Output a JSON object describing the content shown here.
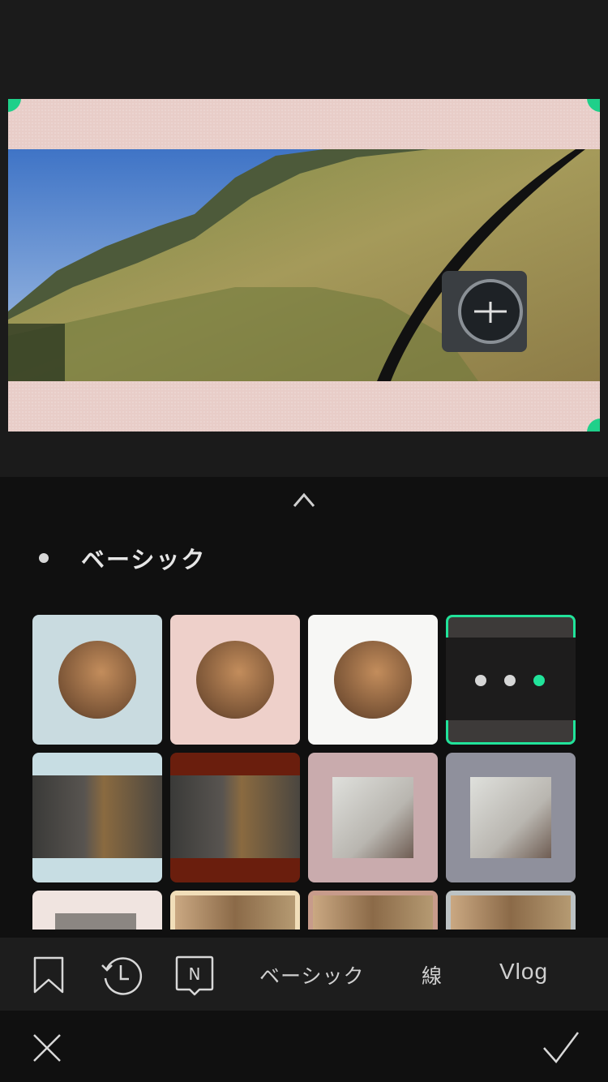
{
  "panel": {
    "section_title": "ベーシック"
  },
  "tabs": [
    {
      "type": "icon",
      "name": "bookmark-icon"
    },
    {
      "type": "icon",
      "name": "history-icon"
    },
    {
      "type": "icon",
      "name": "new-badge-icon",
      "glyph": "N"
    },
    {
      "type": "text",
      "label": "ベーシック"
    },
    {
      "type": "text",
      "label": "線"
    },
    {
      "type": "text",
      "label": "Vlog"
    }
  ],
  "tiles": [
    {
      "style": "circle",
      "bg": "#c9dbe0"
    },
    {
      "style": "circle",
      "bg": "#eed0ca"
    },
    {
      "style": "circle",
      "bg": "#f7f7f5"
    },
    {
      "style": "dots-selected",
      "bg": "#3d3a39",
      "selected": true
    },
    {
      "style": "band",
      "bg": "#c7dde3"
    },
    {
      "style": "band",
      "bg": "#6a1e0d"
    },
    {
      "style": "square",
      "bg": "#c9abad"
    },
    {
      "style": "square",
      "bg": "#8f909c"
    },
    {
      "style": "partial",
      "bg": "#f0e4e0"
    },
    {
      "style": "partial",
      "bg": "#f1deb9"
    },
    {
      "style": "partial",
      "bg": "#c79b8b"
    },
    {
      "style": "partial",
      "bg": "#bcc2c4"
    }
  ],
  "colors": {
    "accent": "#21e39a",
    "preview_frame": "#e8cdc8"
  }
}
